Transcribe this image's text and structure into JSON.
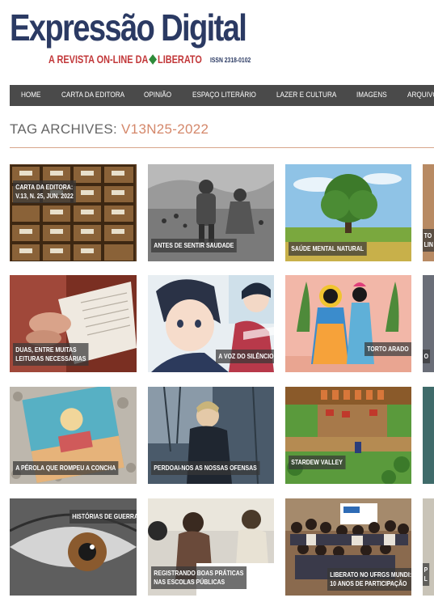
{
  "header": {
    "logo_title": "Expressão Digital",
    "logo_subtitle_a": "A REVISTA ON-LINE DA",
    "logo_subtitle_b": "LIBERATO",
    "issn": "ISSN 2318-0102"
  },
  "nav": {
    "items": [
      "HOME",
      "CARTA DA EDITORA",
      "OPINIÃO",
      "ESPAÇO LITERÁRIO",
      "LAZER E CULTURA",
      "IMAGENS",
      "ARQUIVO"
    ]
  },
  "archive": {
    "prefix": "TAG ARCHIVES:",
    "tag": "V13N25-2022"
  },
  "posts": [
    {
      "line1": "CARTA DA EDITORA:",
      "line2": "V.13, N. 25, JUN. 2022"
    },
    {
      "line1": "ANTES DE SENTIR SAUDADE"
    },
    {
      "line1": "SAÚDE MENTAL NATURAL"
    },
    {
      "line1": "TO",
      "line2": "LIN"
    },
    {
      "line1": "DUAS, ENTRE MUITAS",
      "line2": "LEITURAS NECESSÁRIAS"
    },
    {
      "line1": "A VOZ DO SILÊNCIO"
    },
    {
      "line1": "TORTO ARADO"
    },
    {
      "line1": "O"
    },
    {
      "line1": "A PÉROLA QUE ROMPEU A CONCHA"
    },
    {
      "line1": "PERDOAI-NOS AS NOSSAS OFENSAS"
    },
    {
      "line1": "STARDEW VALLEY"
    },
    {
      "line1": ""
    },
    {
      "line1": "HISTÓRIAS DE GUERRA"
    },
    {
      "line1": "REGISTRANDO BOAS PRÁTICAS",
      "line2": "NAS ESCOLAS PÚBLICAS"
    },
    {
      "line1": "LIBERATO NO UFRGS MUNDI:",
      "line2": "10 ANOS DE PARTICIPAÇÃO"
    },
    {
      "line1": "P",
      "line2": "L"
    }
  ],
  "colors": {
    "logo_blue": "#2b3a63",
    "logo_red": "#c2383a",
    "nav_bg": "#4a4a4a",
    "tag_accent": "#d4876a"
  }
}
